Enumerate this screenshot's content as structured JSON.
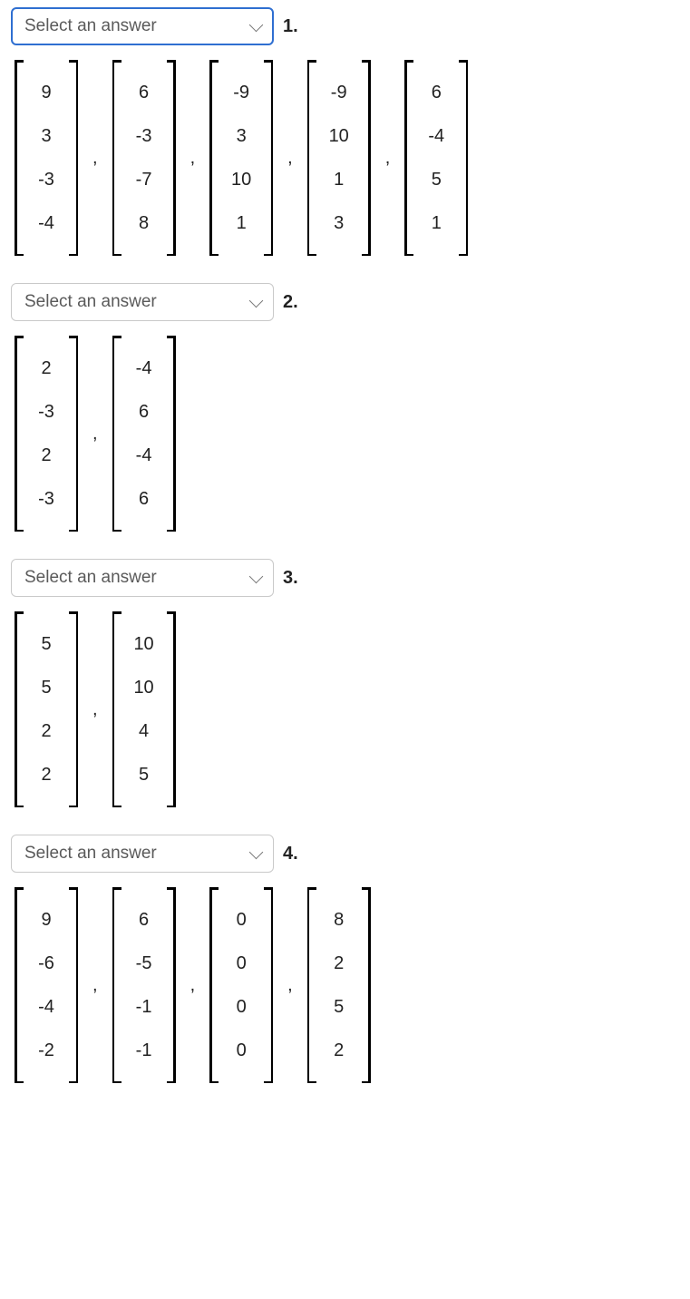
{
  "select_placeholder": "Select an answer",
  "questions": [
    {
      "num": "1.",
      "focused": true,
      "vectors": [
        [
          "9",
          "3",
          "-3",
          "-4"
        ],
        [
          "6",
          "-3",
          "-7",
          "8"
        ],
        [
          "-9",
          "3",
          "10",
          "1"
        ],
        [
          "-9",
          "10",
          "1",
          "3"
        ],
        [
          "6",
          "-4",
          "5",
          "1"
        ]
      ]
    },
    {
      "num": "2.",
      "focused": false,
      "vectors": [
        [
          "2",
          "-3",
          "2",
          "-3"
        ],
        [
          "-4",
          "6",
          "-4",
          "6"
        ]
      ]
    },
    {
      "num": "3.",
      "focused": false,
      "vectors": [
        [
          "5",
          "5",
          "2",
          "2"
        ],
        [
          "10",
          "10",
          "4",
          "5"
        ]
      ]
    },
    {
      "num": "4.",
      "focused": false,
      "vectors": [
        [
          "9",
          "-6",
          "-4",
          "-2"
        ],
        [
          "6",
          "-5",
          "-1",
          "-1"
        ],
        [
          "0",
          "0",
          "0",
          "0"
        ],
        [
          "8",
          "2",
          "5",
          "2"
        ]
      ]
    }
  ]
}
